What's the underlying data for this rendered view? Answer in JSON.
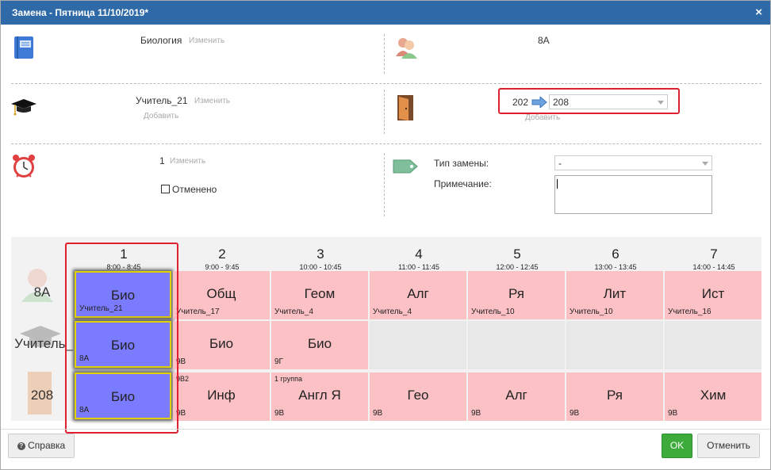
{
  "dialog": {
    "title": "Замена - Пятница 11/10/2019*",
    "close_icon": "×"
  },
  "subject": {
    "value": "Биология",
    "change_link": "Изменить"
  },
  "class": {
    "value": "8А"
  },
  "teacher": {
    "value": "Учитель_21",
    "change_link": "Изменить",
    "add_link": "Добавить"
  },
  "room": {
    "old": "202",
    "new": "208",
    "add_link": "Добавить"
  },
  "lesson": {
    "value": "1",
    "change_link": "Изменить",
    "cancelled_label": "Отменено",
    "cancelled_checked": false
  },
  "substitution_type": {
    "label": "Тип замены:",
    "value": "-"
  },
  "note": {
    "label": "Примечание:",
    "value": ""
  },
  "schedule": {
    "periods": [
      {
        "num": "1",
        "time": "8:00 - 8:45"
      },
      {
        "num": "2",
        "time": "9:00 - 9:45"
      },
      {
        "num": "3",
        "time": "10:00 - 10:45"
      },
      {
        "num": "4",
        "time": "11:00 - 11:45"
      },
      {
        "num": "5",
        "time": "12:00 - 12:45"
      },
      {
        "num": "6",
        "time": "13:00 - 13:45"
      },
      {
        "num": "7",
        "time": "14:00 - 14:45"
      }
    ],
    "row_labels": [
      "8А",
      "Учитель_",
      "208"
    ],
    "rows": [
      [
        {
          "subject": "Био",
          "bottom": "Учитель_21",
          "top": "",
          "style": "blue"
        },
        {
          "subject": "Общ",
          "bottom": "Учитель_17",
          "top": "",
          "style": "pink"
        },
        {
          "subject": "Геом",
          "bottom": "Учитель_4",
          "top": "",
          "style": "pink"
        },
        {
          "subject": "Алг",
          "bottom": "Учитель_4",
          "top": "",
          "style": "pink"
        },
        {
          "subject": "Ря",
          "bottom": "Учитель_10",
          "top": "",
          "style": "pink"
        },
        {
          "subject": "Лит",
          "bottom": "Учитель_10",
          "top": "",
          "style": "pink"
        },
        {
          "subject": "Ист",
          "bottom": "Учитель_16",
          "top": "",
          "style": "pink"
        }
      ],
      [
        {
          "subject": "Био",
          "bottom": "8А",
          "top": "",
          "style": "blue"
        },
        {
          "subject": "Био",
          "bottom": "9В",
          "top": "",
          "style": "pink"
        },
        {
          "subject": "Био",
          "bottom": "9Г",
          "top": "",
          "style": "pink"
        },
        {
          "subject": "",
          "bottom": "",
          "top": "",
          "style": "grey"
        },
        {
          "subject": "",
          "bottom": "",
          "top": "",
          "style": "grey"
        },
        {
          "subject": "",
          "bottom": "",
          "top": "",
          "style": "grey"
        },
        {
          "subject": "",
          "bottom": "",
          "top": "",
          "style": "grey"
        }
      ],
      [
        {
          "subject": "Био",
          "bottom": "8А",
          "top": "",
          "style": "blue"
        },
        {
          "subject": "Инф",
          "bottom": "9В",
          "top": "9В2",
          "style": "pink"
        },
        {
          "subject": "Англ Я",
          "bottom": "9В",
          "top": "1 группа",
          "style": "pink"
        },
        {
          "subject": "Гео",
          "bottom": "9В",
          "top": "",
          "style": "pink"
        },
        {
          "subject": "Алг",
          "bottom": "9В",
          "top": "",
          "style": "pink"
        },
        {
          "subject": "Ря",
          "bottom": "9В",
          "top": "",
          "style": "pink"
        },
        {
          "subject": "Хим",
          "bottom": "9В",
          "top": "",
          "style": "pink"
        }
      ]
    ]
  },
  "footer": {
    "help_label": "Справка",
    "ok_label": "OK",
    "cancel_label": "Отменить"
  },
  "icons": {
    "book": "book-icon",
    "class": "users-icon",
    "teacher": "graduation-cap-icon",
    "room": "door-icon",
    "alarm": "alarm-clock-icon",
    "tag": "tag-icon",
    "help": "question-icon"
  },
  "colors": {
    "title_bar": "#2f6aa8",
    "cell_pink": "#fbc1c5",
    "cell_blue": "#7b7bff",
    "highlight_red": "#e02030",
    "ok_green": "#3cab3c"
  }
}
